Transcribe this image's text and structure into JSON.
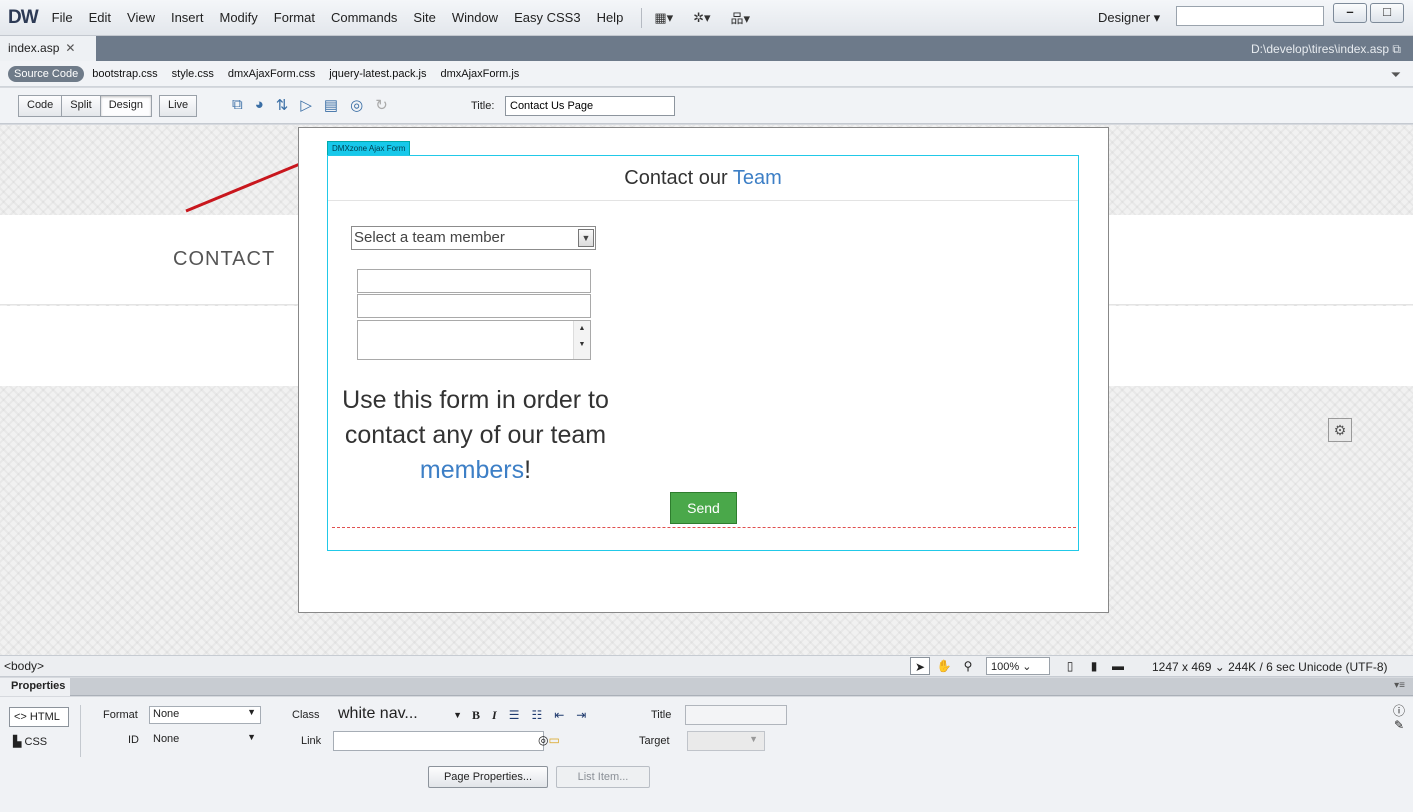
{
  "app": {
    "logo": "DW",
    "menu": [
      "File",
      "Edit",
      "View",
      "Insert",
      "Modify",
      "Format",
      "Commands",
      "Site",
      "Window",
      "Easy CSS3",
      "Help"
    ],
    "workspace": "Designer",
    "search_placeholder": ""
  },
  "document": {
    "tab": "index.asp",
    "path": "D:\\develop\\tires\\index.asp",
    "related_files": [
      "Source Code",
      "bootstrap.css",
      "style.css",
      "dmxAjaxForm.css",
      "jquery-latest.pack.js",
      "dmxAjaxForm.js"
    ]
  },
  "toolbar": {
    "views": [
      "Code",
      "Split",
      "Design",
      "Live"
    ],
    "title_label": "Title:",
    "title_value": "Contact Us Page"
  },
  "design": {
    "contact_heading": "CONTACT",
    "form_tag": "DMXzone Ajax Form",
    "header_text": "Contact our",
    "header_accent": "Team",
    "select_value": "Select a team member",
    "text_line1": "Use this form in order to",
    "text_line2": "contact any of our team",
    "text_accent": "members",
    "text_end": "!",
    "send_label": "Send"
  },
  "statusbar": {
    "tag": "<body>",
    "zoom": "100%",
    "info": "1247 x 469 ⌄  244K / 6 sec  Unicode (UTF-8)"
  },
  "properties": {
    "title": "Properties",
    "html_label": "HTML",
    "css_label": "CSS",
    "format_label": "Format",
    "format_value": "None",
    "id_label": "ID",
    "id_value": "None",
    "class_label": "Class",
    "class_value": "white nav...",
    "link_label": "Link",
    "title_label": "Title",
    "target_label": "Target",
    "page_properties": "Page Properties...",
    "list_item": "List Item..."
  },
  "colors": {
    "accent": "#3d7fc6",
    "send": "#4aa84a",
    "form_border": "#21c9e8"
  }
}
